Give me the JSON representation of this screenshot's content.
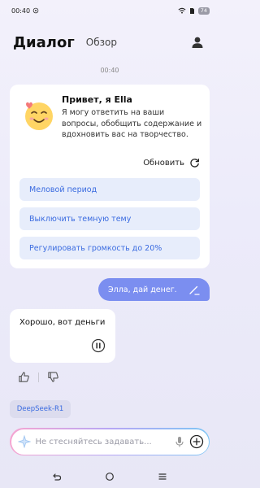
{
  "status_bar": {
    "time": "00:40",
    "battery": "74"
  },
  "header": {
    "title": "Диалог",
    "overview_tab": "Обзор"
  },
  "chat": {
    "timestamp": "00:40"
  },
  "welcome": {
    "title": "Привет, я Ella",
    "text": "Я могу ответить на ваши вопросы, обобщить содержание и вдохновить вас на творчество.",
    "refresh_label": "Обновить",
    "suggestions": [
      "Меловой период",
      "Выключить темную тему",
      "Регулировать громкость до 20%"
    ]
  },
  "messages": {
    "user": "Элла, дай денег.",
    "bot": "Хорошо, вот деньги"
  },
  "model": {
    "name": "DeepSeek-R1"
  },
  "input": {
    "placeholder": "Не стесняйтесь задавать..."
  },
  "colors": {
    "accent": "#7b8ef0",
    "link": "#3a6be0",
    "suggestion_bg": "#e7edfb"
  }
}
